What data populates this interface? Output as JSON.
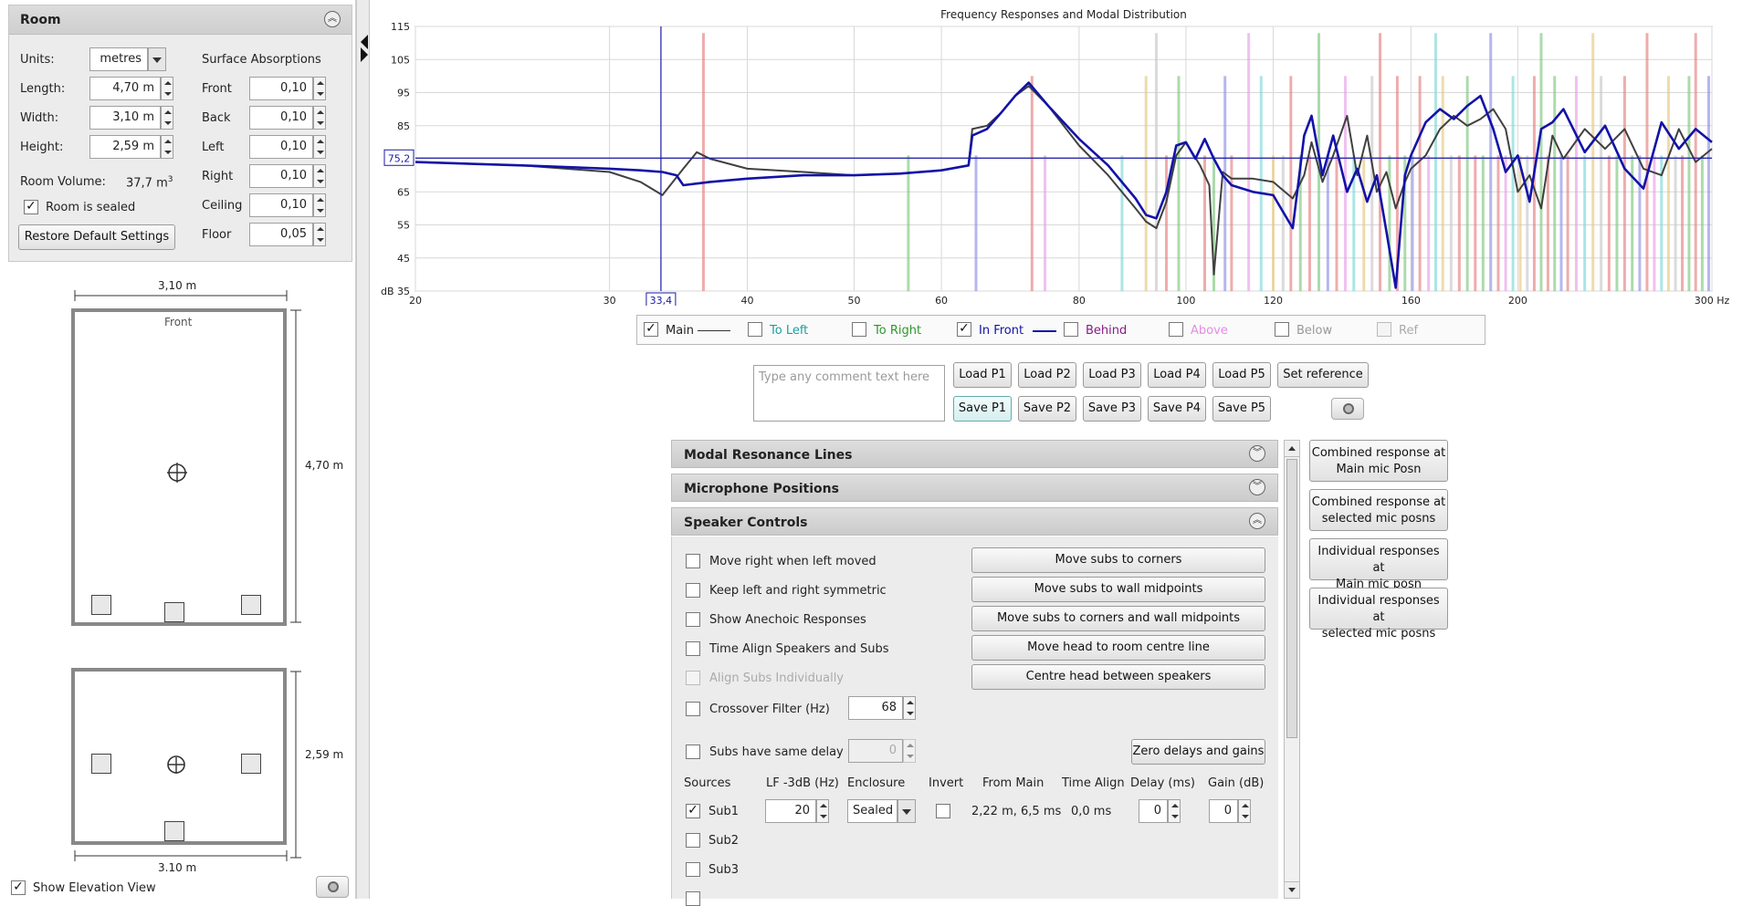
{
  "room_panel": {
    "title": "Room",
    "units_label": "Units:",
    "units_value": "metres",
    "length_label": "Length:",
    "length_value": "4,70 m",
    "width_label": "Width:",
    "width_value": "3,10 m",
    "height_label": "Height:",
    "height_value": "2,59 m",
    "volume_label": "Room Volume:",
    "volume_value": "37,7 m",
    "volume_exp": "3",
    "sealed_label": "Room is sealed",
    "sealed_checked": "✓",
    "restore_label": "Restore Default Settings",
    "absorptions_title": "Surface Absorptions",
    "absorptions": [
      {
        "label": "Front",
        "value": "0,10"
      },
      {
        "label": "Back",
        "value": "0,10"
      },
      {
        "label": "Left",
        "value": "0,10"
      },
      {
        "label": "Right",
        "value": "0,10"
      },
      {
        "label": "Ceiling",
        "value": "0,10"
      },
      {
        "label": "Floor",
        "value": "0,05"
      }
    ]
  },
  "plan_view": {
    "width_dim": "3,10 m",
    "length_dim": "4,70 m",
    "front_label": "Front"
  },
  "elevation_view": {
    "height_dim": "2,59 m",
    "width_dim": "3.10 m",
    "show_label": "Show Elevation View",
    "show_checked": "✓"
  },
  "chart_data": {
    "type": "line",
    "title": "Frequency Responses and Modal Distribution",
    "x_scale": "log",
    "xlim": [
      20,
      300
    ],
    "ylim": [
      35,
      115
    ],
    "x_ticks": [
      "20",
      "30",
      "40",
      "50",
      "60",
      "80",
      "100",
      "120",
      "160",
      "200",
      "300 Hz"
    ],
    "x_tick_values": [
      20,
      30,
      40,
      50,
      60,
      80,
      100,
      120,
      160,
      200,
      300
    ],
    "y_ticks": [
      "115",
      "105",
      "95",
      "85",
      "75",
      "65",
      "55",
      "45",
      "dB 35"
    ],
    "y_tick_values": [
      115,
      105,
      95,
      85,
      75,
      65,
      55,
      45,
      35
    ],
    "grid": true,
    "cursor": {
      "x": 33.4,
      "y": 75.2,
      "x_label": "33,4",
      "y_label": "75,2"
    },
    "series": [
      {
        "name": "Main",
        "color": "#404040",
        "x": [
          20,
          25,
          30,
          32,
          33.5,
          35,
          36,
          37,
          40,
          45,
          50,
          55,
          60,
          63.5,
          64,
          66,
          68,
          70,
          72,
          75,
          80,
          85,
          90,
          92,
          94,
          96,
          98,
          100,
          103,
          105,
          106,
          108,
          110,
          115,
          120,
          125,
          128,
          130,
          133,
          136,
          140,
          143,
          146,
          149,
          152,
          155,
          158,
          160,
          165,
          170,
          175,
          180,
          185,
          190,
          195,
          200,
          205,
          210,
          215,
          220,
          230,
          240,
          250,
          260,
          270,
          280,
          290,
          300
        ],
        "y": [
          74,
          73,
          71,
          68,
          64,
          72,
          77,
          75,
          72,
          71,
          70,
          70.5,
          71.5,
          73,
          84,
          85,
          89,
          94,
          97,
          91,
          79,
          70,
          60,
          56,
          54,
          62,
          76,
          80,
          73,
          67,
          40,
          71,
          69,
          69,
          68,
          63,
          70,
          80,
          68,
          76,
          88,
          70,
          82,
          65,
          71,
          60,
          68,
          72,
          76,
          84,
          88,
          85,
          87,
          90,
          84,
          65,
          70,
          60,
          82,
          75,
          84,
          78,
          84,
          72,
          70,
          84,
          74,
          78
        ]
      },
      {
        "name": "In Front",
        "color": "#1212a8",
        "x": [
          20,
          25,
          30,
          32,
          33.5,
          34.5,
          35,
          36,
          37,
          40,
          45,
          50,
          55,
          60,
          63.5,
          64,
          66,
          68,
          70,
          72,
          75,
          80,
          85,
          90,
          92,
          94,
          96,
          98,
          100,
          102,
          104,
          106,
          108,
          110,
          115,
          120,
          125,
          128,
          130,
          133,
          136,
          140,
          143,
          146,
          149,
          152,
          155,
          158,
          160,
          165,
          170,
          175,
          180,
          185,
          190,
          195,
          200,
          205,
          210,
          215,
          220,
          230,
          240,
          250,
          260,
          270,
          280,
          290,
          300
        ],
        "y": [
          74,
          73,
          72,
          71.5,
          71,
          70,
          67,
          67.5,
          68,
          69,
          70,
          70,
          70.5,
          71.5,
          73,
          82,
          84,
          89,
          94,
          98,
          91,
          81,
          73,
          63,
          58,
          57,
          65,
          79,
          80,
          75,
          81,
          75,
          70,
          67,
          65,
          64,
          54,
          82,
          88,
          70,
          82,
          65,
          72,
          62,
          70,
          53,
          36,
          70,
          76,
          86,
          90,
          87,
          91,
          94,
          84,
          71,
          76,
          62,
          84,
          86,
          90,
          77,
          85,
          72,
          66,
          86,
          78,
          84,
          80
        ]
      }
    ],
    "mode_lines_hz": [
      36.5,
      56,
      64.5,
      72.5,
      74.5,
      87.5,
      92,
      94,
      96,
      98.5,
      104,
      106,
      108.5,
      110,
      114,
      117,
      120,
      122.5,
      124.5,
      127,
      129.5,
      132,
      134.5,
      137,
      139.5,
      142,
      145,
      147.5,
      150,
      153,
      155.5,
      158,
      160.5,
      163,
      166,
      168.5,
      171,
      174,
      177,
      180,
      183,
      186,
      189,
      192,
      195,
      198,
      201,
      204,
      207,
      210,
      213,
      216,
      219,
      222,
      226,
      230,
      234,
      238,
      242,
      246,
      250,
      254,
      258,
      262,
      266,
      270,
      274,
      278,
      282,
      286,
      290,
      294,
      298
    ],
    "mode_colors": [
      "#e88080",
      "#80c880",
      "#9090e8",
      "#e88080",
      "#e8a0e8",
      "#80d8d8",
      "#e8c880",
      "#c8c8c8",
      "#e88080",
      "#80c880"
    ]
  },
  "legend": {
    "main_label": "Main",
    "main_checked": "✓",
    "to_left_label": "To Left",
    "to_right_label": "To Right",
    "in_front_label": "In Front",
    "in_front_checked": "✓",
    "behind_label": "Behind",
    "above_label": "Above",
    "below_label": "Below",
    "ref_label": "Ref"
  },
  "comment": {
    "placeholder": "Type any comment text here"
  },
  "load_buttons": [
    "Load P1",
    "Load P2",
    "Load P3",
    "Load P4",
    "Load P5"
  ],
  "set_reference_label": "Set reference",
  "save_buttons": [
    "Save P1",
    "Save P2",
    "Save P3",
    "Save P4",
    "Save P5"
  ],
  "sections": {
    "modal": "Modal Resonance Lines",
    "mics": "Microphone Positions",
    "speakers": "Speaker Controls"
  },
  "speaker_controls": {
    "options": [
      {
        "label": "Move right when left moved",
        "checked": ""
      },
      {
        "label": "Keep left and right symmetric",
        "checked": ""
      },
      {
        "label": "Show Anechoic Responses",
        "checked": ""
      },
      {
        "label": "Time Align Speakers and Subs",
        "checked": ""
      },
      {
        "label": "Align Subs Individually",
        "checked": ""
      }
    ],
    "crossover_label": "Crossover Filter (Hz)",
    "crossover_value": "68",
    "same_delay_label": "Subs have same delay",
    "same_delay_value": "0",
    "actions": [
      "Move subs to corners",
      "Move subs to wall midpoints",
      "Move subs to corners and wall midpoints",
      "Move head to room centre line",
      "Centre head between speakers"
    ],
    "zero_label": "Zero delays and gains",
    "headers": {
      "sources": "Sources",
      "lf": "LF -3dB (Hz)",
      "enclosure": "Enclosure",
      "invert": "Invert",
      "from_main": "From Main",
      "time_align": "Time Align",
      "delay": "Delay (ms)",
      "gain": "Gain (dB)"
    },
    "sub1": {
      "label": "Sub1",
      "checked": "✓",
      "lf": "20",
      "enclosure": "Sealed",
      "from_main": "2,22 m, 6,5 ms",
      "time_align": "0,0 ms",
      "delay": "0",
      "gain": "0"
    },
    "sub2_label": "Sub2",
    "sub3_label": "Sub3"
  },
  "side_buttons": [
    {
      "line1": "Combined response at",
      "line2": "Main mic Posn"
    },
    {
      "line1": "Combined response at",
      "line2": "selected mic posns"
    },
    {
      "line1": "Individual responses at",
      "line2": "Main mic posn"
    },
    {
      "line1": "Individual responses at",
      "line2": "selected mic posns"
    }
  ]
}
